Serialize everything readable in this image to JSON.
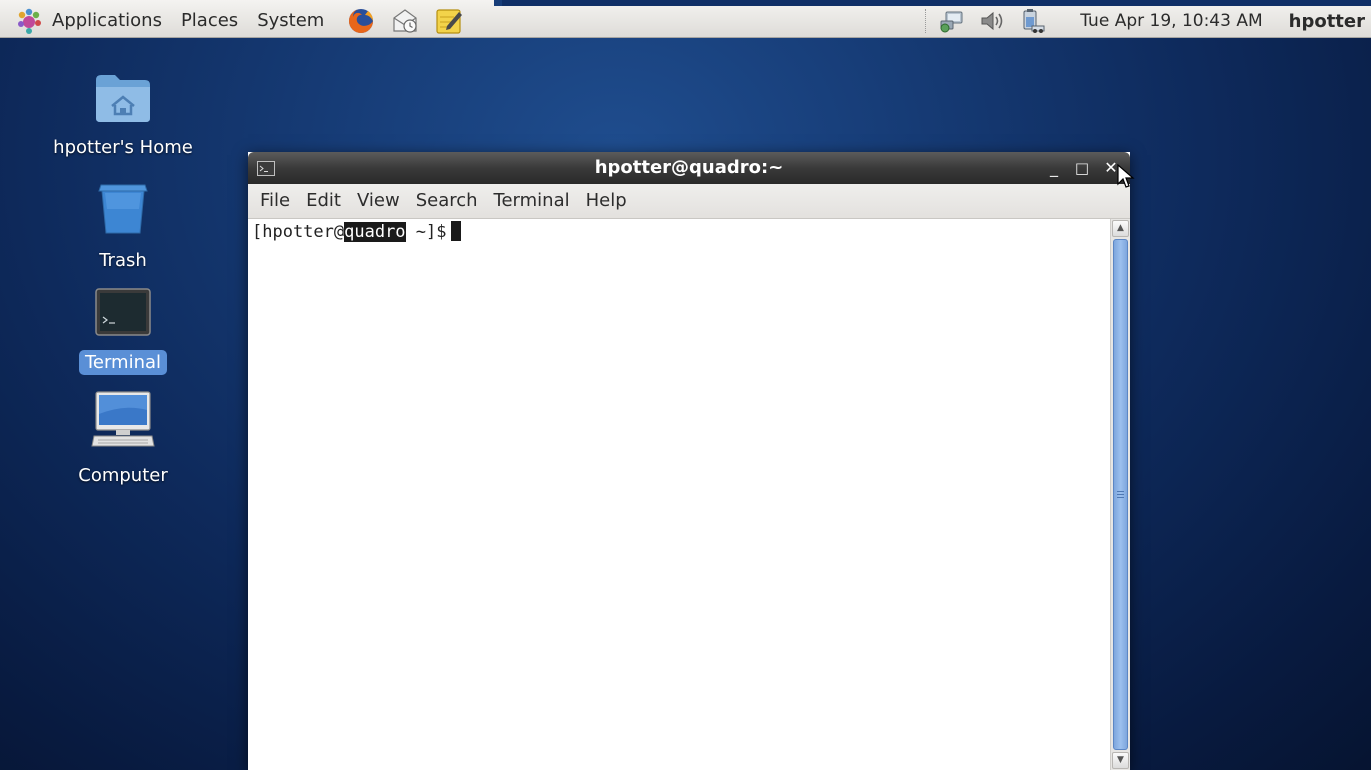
{
  "panel": {
    "menus": [
      {
        "label": "Applications",
        "icon": "gnome-foot-icon"
      },
      {
        "label": "Places"
      },
      {
        "label": "System"
      }
    ],
    "launchers": [
      "firefox-icon",
      "mail-icon",
      "notes-icon"
    ],
    "tray": [
      "network-icon",
      "volume-icon",
      "power-icon"
    ],
    "clock": "Tue Apr 19, 10:43 AM",
    "user": "hpotter"
  },
  "desktop": {
    "icons": [
      {
        "label": "hpotter's Home",
        "icon": "home-folder-icon",
        "selected": false
      },
      {
        "label": "Trash",
        "icon": "trash-icon",
        "selected": false
      },
      {
        "label": "Terminal",
        "icon": "terminal-icon",
        "selected": true
      },
      {
        "label": "Computer",
        "icon": "computer-icon",
        "selected": false
      }
    ]
  },
  "terminal": {
    "title": "hpotter@quadro:~",
    "controls": {
      "minimize": "_",
      "maximize": "□",
      "close": "✕"
    },
    "menus": [
      "File",
      "Edit",
      "View",
      "Search",
      "Terminal",
      "Help"
    ],
    "prompt_prefix": "[hpotter@",
    "prompt_selected": "quadro",
    "prompt_suffix": " ~]$"
  },
  "colors": {
    "desktop_bg": "#173d78",
    "selection_bg": "#5a8fd6",
    "scrollbar_thumb": "#8fb4e8"
  }
}
